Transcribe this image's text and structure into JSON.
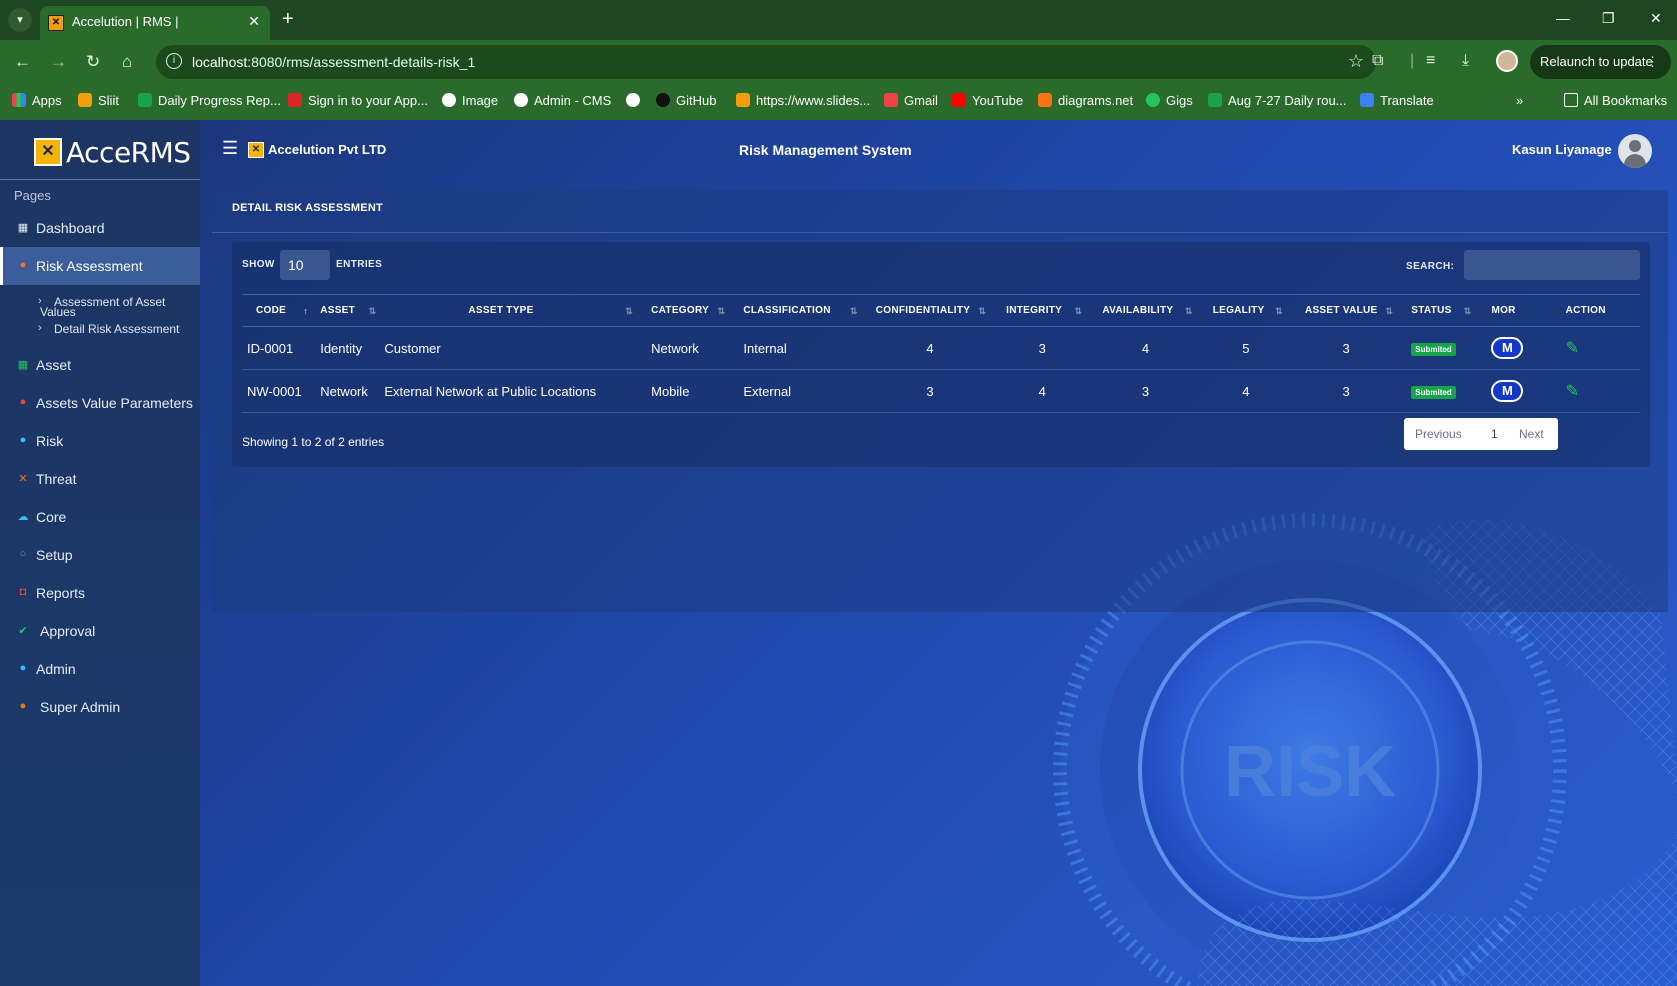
{
  "browser": {
    "tab_title": "Accelution | RMS |",
    "favicon_text": "✕",
    "url_host": "localhost",
    "url_rest": ":8080/rms/assessment-details-risk_1",
    "relaunch_label": "Relaunch to update",
    "bookmarks": [
      "Apps",
      "Sliit",
      "Daily Progress Rep...",
      "Sign in to your App...",
      "Image",
      "Admin - CMS",
      "",
      "GitHub",
      "https://www.slides...",
      "Gmail",
      "YouTube",
      "diagrams.net",
      "Gigs",
      "Aug 7-27 Daily rou...",
      "Translate"
    ],
    "all_bookmarks_label": "All Bookmarks",
    "overflow_label": "»"
  },
  "app": {
    "logo_text": "AcceRMS",
    "company": "Accelution Pvt LTD",
    "system_title": "Risk Management System",
    "user_name": "Kasun Liyanage"
  },
  "sidebar": {
    "section_label": "Pages",
    "items": [
      {
        "label": "Dashboard",
        "icon": "▦",
        "color": "#e6ecf7"
      },
      {
        "label": "Risk Assessment",
        "icon": "●",
        "color": "#f97316"
      },
      {
        "label": "Asset",
        "icon": "▦",
        "color": "#22c55e"
      },
      {
        "label": "Assets Value Parameters",
        "icon": "●",
        "color": "#ef4444"
      },
      {
        "label": "Risk",
        "icon": "●",
        "color": "#38bdf8"
      },
      {
        "label": "Threat",
        "icon": "✕",
        "color": "#f97316"
      },
      {
        "label": "Core",
        "icon": "☁",
        "color": "#38bdf8"
      },
      {
        "label": "Setup",
        "icon": "○",
        "color": "#22c55e"
      },
      {
        "label": "Reports",
        "icon": "◘",
        "color": "#ef4444"
      },
      {
        "label": "Approval",
        "icon": "👍",
        "color": "#22c55e"
      },
      {
        "label": "Admin",
        "icon": "●",
        "color": "#38bdf8"
      },
      {
        "label": "Super Admin",
        "icon": "👥",
        "color": "#f97316"
      }
    ],
    "sub_items": [
      {
        "label_line1": "Assessment of Asset",
        "label_line2": "Values"
      },
      {
        "label_line1": "Detail Risk Assessment",
        "label_line2": ""
      }
    ]
  },
  "card": {
    "title": "DETAIL RISK ASSESSMENT",
    "show_label": "SHOW",
    "entries_value": "10",
    "entries_label": "ENTRIES",
    "search_label": "SEARCH:",
    "search_value": "",
    "columns": [
      "CODE",
      "ASSET",
      "ASSET TYPE",
      "CATEGORY",
      "CLASSIFICATION",
      "CONFIDENTIALITY",
      "INTEGRITY",
      "AVAILABILITY",
      "LEGALITY",
      "ASSET VALUE",
      "STATUS",
      "MOR",
      "ACTION"
    ],
    "rows": [
      {
        "code": "ID-0001",
        "asset": "Identity",
        "asset_type": "Customer",
        "category": "Network",
        "classification": "Internal",
        "confidentiality": "4",
        "integrity": "3",
        "availability": "4",
        "legality": "5",
        "asset_value": "3",
        "status": "Submited",
        "mor": "M"
      },
      {
        "code": "NW-0001",
        "asset": "Network",
        "asset_type": "External Network at Public Locations",
        "category": "Mobile",
        "classification": "External",
        "confidentiality": "3",
        "integrity": "4",
        "availability": "3",
        "legality": "4",
        "asset_value": "3",
        "status": "Submited",
        "mor": "M"
      }
    ],
    "info_text": "Showing 1 to 2 of 2 entries",
    "pager": {
      "previous": "Previous",
      "page": "1",
      "next": "Next"
    }
  },
  "background_text": "RISK"
}
